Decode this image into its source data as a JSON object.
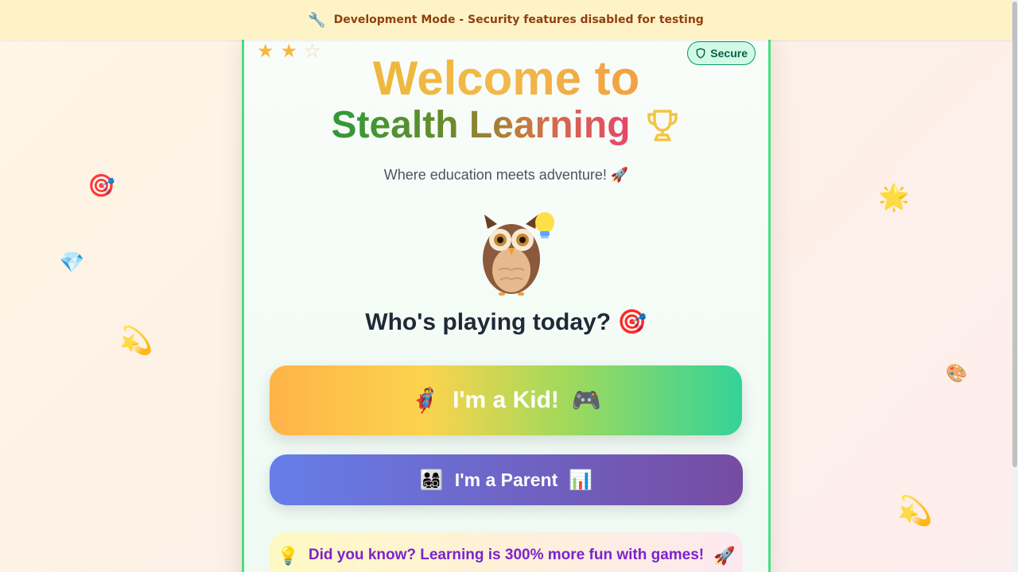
{
  "banner": {
    "icon": "wrench-icon",
    "text": "Development Mode - Security features disabled for testing"
  },
  "decorations": {
    "floating_icons": [
      "target-icon",
      "gem-icon",
      "sparkle-star-icon",
      "glowing-star-icon",
      "palette-icon",
      "dizzy-star-icon"
    ]
  },
  "card": {
    "stars": {
      "filled": 2,
      "total": 3
    },
    "secure_badge": {
      "icon": "shield-icon",
      "label": "Secure"
    },
    "title_line1": "Welcome to",
    "title_line2": "Stealth Learning",
    "title_icon": "trophy-icon",
    "subtitle": "Where education meets adventure! 🚀",
    "mascot": "owl-icon",
    "mascot_accessory": "lightbulb-icon",
    "question": "Who's playing today? 🎯",
    "kid_button": {
      "icon_left": "🦸",
      "label": "I'm a Kid!",
      "icon_right": "🎮"
    },
    "parent_button": {
      "icon_left": "👨‍👩‍👧‍👦",
      "label": "I'm a Parent",
      "icon_right": "📊"
    },
    "fun_fact": {
      "icon_left": "💡",
      "text": "Did you know? Learning is 300% more fun with games!",
      "icon_right": "🚀"
    }
  },
  "colors": {
    "banner_bg": "#fef3c7",
    "banner_text": "#92400e",
    "card_border": "#4ade80",
    "secure_bg": "#d1fae5",
    "secure_text": "#065f46",
    "parent_gradient": [
      "#667eea",
      "#764ba2"
    ],
    "fact_text": "#7e22ce"
  }
}
